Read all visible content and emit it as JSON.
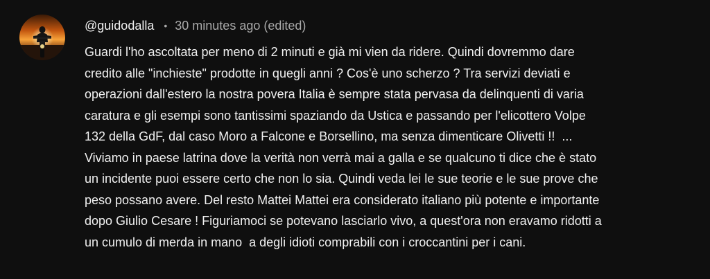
{
  "comment": {
    "author": "@guidodalla",
    "separator": "•",
    "timestamp": "30 minutes ago (edited)",
    "avatar_icon": "motorcycle-rider-sunset-avatar",
    "lines": [
      "Guardi l'ho ascoltata per meno di 2 minuti e già mi vien da ridere. Quindi dovremmo dare",
      "credito alle \"inchieste\" prodotte in quegli anni ? Cos'è uno scherzo ? Tra servizi deviati e",
      "operazioni dall'estero la nostra povera Italia è sempre stata pervasa da delinquenti di varia",
      "caratura e gli esempi sono tantissimi spaziando da Ustica e passando per l'elicottero Volpe",
      "132 della GdF, dal caso Moro a Falcone e Borsellino, ma senza dimenticare Olivetti !!  ...",
      "Viviamo in paese latrina dove la verità non verrà mai a galla e se qualcuno ti dice che è stato",
      "un incidente puoi essere certo che non lo sia. Quindi veda lei le sue teorie e le sue prove che",
      "peso possano avere. Del resto Mattei Mattei era considerato italiano più potente e importante",
      "dopo Giulio Cesare ! Figuriamoci se potevano lasciarlo vivo, a quest'ora non eravamo ridotti a",
      "un cumulo di merda in mano  a degli idioti comprabili con i croccantini per i cani."
    ]
  },
  "colors": {
    "background": "#0f0f0f",
    "primary_text": "#f1f1f1",
    "secondary_text": "#aaaaaa"
  }
}
